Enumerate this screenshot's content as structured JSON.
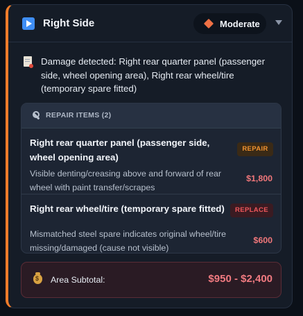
{
  "header": {
    "title": "Right Side",
    "severity": "Moderate",
    "colors": {
      "accent_border": "#f07c2a",
      "severity_diamond": "#ef7145"
    }
  },
  "damage": {
    "text": "Damage detected: Right rear quarter panel (passenger side, wheel opening area), Right rear wheel/tire (temporary spare fitted)"
  },
  "repairs": {
    "heading": "REPAIR ITEMS (2)",
    "items": [
      {
        "title": "Right rear quarter panel (passenger side, wheel opening area)",
        "tag": "REPAIR",
        "description": "Visible denting/creasing above and forward of rear wheel with paint transfer/scrapes",
        "price": "$1,800"
      },
      {
        "title": "Right rear wheel/tire (temporary spare fitted)",
        "tag": "REPLACE",
        "description": "Mismatched steel spare indicates original wheel/tire missing/damaged (cause not visible)",
        "price": "$600"
      }
    ]
  },
  "subtotal": {
    "label": "Area Subtotal:",
    "value": "$950 - $2,400"
  },
  "icons": [
    "play-icon",
    "diamond-icon",
    "chevron-down-icon",
    "document-icon",
    "wrench-icon",
    "money-bag-icon"
  ]
}
